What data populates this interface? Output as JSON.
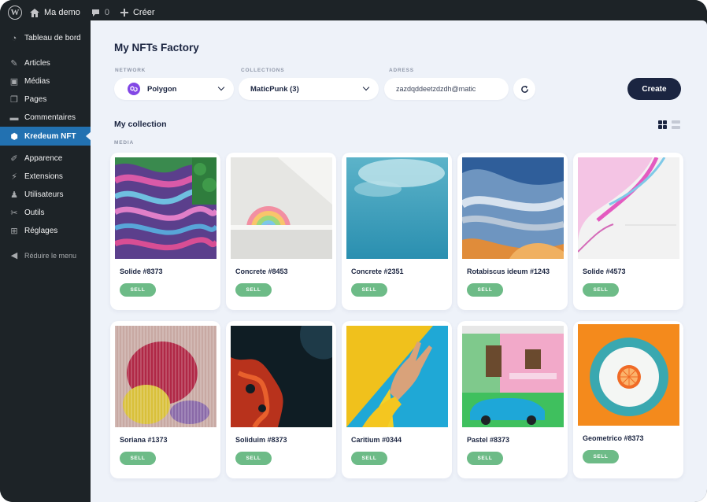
{
  "adminbar": {
    "site_name": "Ma demo",
    "comments_count": "0",
    "new_label": "Créer"
  },
  "sidebar": {
    "items": [
      {
        "label": "Tableau de bord",
        "icon": "dashboard-icon"
      },
      {
        "label": "Articles",
        "icon": "pin-icon"
      },
      {
        "label": "Médias",
        "icon": "media-icon"
      },
      {
        "label": "Pages",
        "icon": "pages-icon"
      },
      {
        "label": "Commentaires",
        "icon": "comments-icon"
      },
      {
        "label": "Kredeum NFT",
        "icon": "kredeum-icon",
        "active": true
      },
      {
        "label": "Apparence",
        "icon": "brush-icon"
      },
      {
        "label": "Extensions",
        "icon": "plugin-icon"
      },
      {
        "label": "Utilisateurs",
        "icon": "users-icon"
      },
      {
        "label": "Outils",
        "icon": "wrench-icon"
      },
      {
        "label": "Réglages",
        "icon": "settings-icon"
      }
    ],
    "collapse_label": "Réduire le menu"
  },
  "main": {
    "title": "My NFTs Factory",
    "network": {
      "label": "NETWORK",
      "value": "Polygon"
    },
    "collections": {
      "label": "COLLECTIONS",
      "value": "MaticPunk (3)"
    },
    "adress": {
      "label": "ADRESS",
      "value": "zazdqddeetzdzdh@matic"
    },
    "create_label": "Create",
    "collection_title": "My collection",
    "media_label": "MEDIA",
    "sell_label": "SELL"
  },
  "cards": [
    {
      "name": "Solide #8373",
      "art": "terraces"
    },
    {
      "name": "Concrete #8453",
      "art": "rainbow"
    },
    {
      "name": "Concrete #2351",
      "art": "sky"
    },
    {
      "name": "Rotabiscus ideum #1243",
      "art": "fluid-blue"
    },
    {
      "name": "Solide #4573",
      "art": "ink-pink"
    },
    {
      "name": "Soriana #1373",
      "art": "glass-red"
    },
    {
      "name": "Soliduim #8373",
      "art": "lava"
    },
    {
      "name": "Caritium #0344",
      "art": "peace-hand"
    },
    {
      "name": "Pastel #8373",
      "art": "pastel-house"
    },
    {
      "name": "Geometrico #8373",
      "art": "orange-plate"
    }
  ],
  "colors": {
    "sidebar_bg": "#1d2327",
    "active_menu": "#2271b1",
    "main_bg": "#eef2f9",
    "primary_dark": "#1b2541",
    "sell_green": "#6dbb87",
    "polygon_purple": "#8247e5"
  }
}
